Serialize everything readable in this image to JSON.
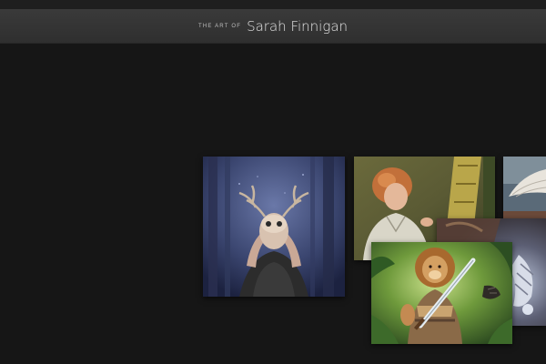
{
  "header": {
    "prefix": "THE ART OF",
    "name": "Sarah Finnigan"
  },
  "gallery": {
    "items": [
      {
        "subject": "antlered-mask-figure"
      },
      {
        "subject": "red-haired-scribe"
      },
      {
        "subject": "winged-figure"
      },
      {
        "subject": "armored-creature"
      },
      {
        "subject": "lion-warrior"
      }
    ]
  },
  "colors": {
    "background": "#161616",
    "header": "#343434",
    "title_text": "#e6e6e6"
  }
}
